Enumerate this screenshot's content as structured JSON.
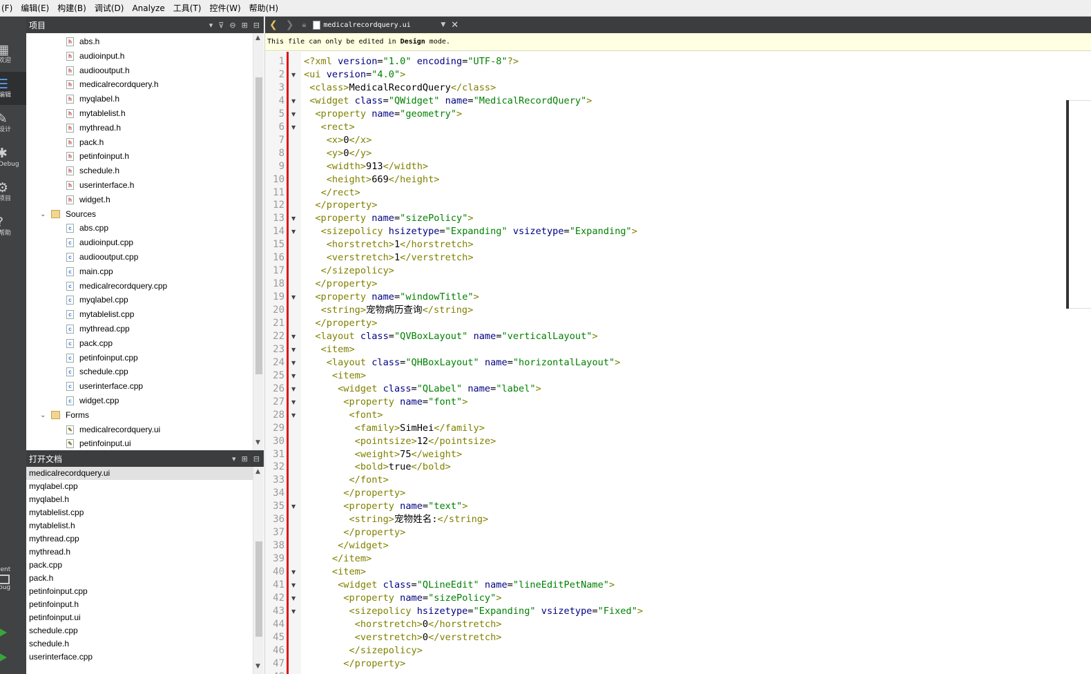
{
  "menu": [
    "(F)",
    "编辑(E)",
    "构建(B)",
    "调试(D)",
    "Analyze",
    "工具(T)",
    "控件(W)",
    "帮助(H)"
  ],
  "modes": [
    {
      "icon": "grid-icon",
      "glyph": "▦",
      "label": "欢迎",
      "active": false
    },
    {
      "icon": "edit-mode-icon",
      "glyph": "☰",
      "label": "编辑",
      "active": true
    },
    {
      "icon": "design-icon",
      "glyph": "✎",
      "label": "设计",
      "active": false
    },
    {
      "icon": "debug-icon",
      "glyph": "✱",
      "label": "Debug",
      "active": false
    },
    {
      "icon": "wrench-icon",
      "glyph": "⚙",
      "label": "项目",
      "active": false
    },
    {
      "icon": "help-icon",
      "glyph": "?",
      "label": "帮助",
      "active": false
    }
  ],
  "kit": {
    "label": "ient",
    "sublabel": "bug"
  },
  "project_panel": {
    "title": "项目"
  },
  "project_tree": [
    {
      "type": "h",
      "label": "abs.h",
      "indent": 2
    },
    {
      "type": "h",
      "label": "audioinput.h",
      "indent": 2
    },
    {
      "type": "h",
      "label": "audiooutput.h",
      "indent": 2
    },
    {
      "type": "h",
      "label": "medicalrecordquery.h",
      "indent": 2
    },
    {
      "type": "h",
      "label": "myqlabel.h",
      "indent": 2
    },
    {
      "type": "h",
      "label": "mytablelist.h",
      "indent": 2
    },
    {
      "type": "h",
      "label": "mythread.h",
      "indent": 2
    },
    {
      "type": "h",
      "label": "pack.h",
      "indent": 2
    },
    {
      "type": "h",
      "label": "petinfoinput.h",
      "indent": 2
    },
    {
      "type": "h",
      "label": "schedule.h",
      "indent": 2
    },
    {
      "type": "h",
      "label": "userinterface.h",
      "indent": 2
    },
    {
      "type": "h",
      "label": "widget.h",
      "indent": 2
    },
    {
      "type": "folder",
      "label": "Sources",
      "indent": 1
    },
    {
      "type": "c",
      "label": "abs.cpp",
      "indent": 2
    },
    {
      "type": "c",
      "label": "audioinput.cpp",
      "indent": 2
    },
    {
      "type": "c",
      "label": "audiooutput.cpp",
      "indent": 2
    },
    {
      "type": "c",
      "label": "main.cpp",
      "indent": 2
    },
    {
      "type": "c",
      "label": "medicalrecordquery.cpp",
      "indent": 2
    },
    {
      "type": "c",
      "label": "myqlabel.cpp",
      "indent": 2
    },
    {
      "type": "c",
      "label": "mytablelist.cpp",
      "indent": 2
    },
    {
      "type": "c",
      "label": "mythread.cpp",
      "indent": 2
    },
    {
      "type": "c",
      "label": "pack.cpp",
      "indent": 2
    },
    {
      "type": "c",
      "label": "petinfoinput.cpp",
      "indent": 2
    },
    {
      "type": "c",
      "label": "schedule.cpp",
      "indent": 2
    },
    {
      "type": "c",
      "label": "userinterface.cpp",
      "indent": 2
    },
    {
      "type": "c",
      "label": "widget.cpp",
      "indent": 2
    },
    {
      "type": "folder",
      "label": "Forms",
      "indent": 1
    },
    {
      "type": "ui",
      "label": "medicalrecordquery.ui",
      "indent": 2
    },
    {
      "type": "ui",
      "label": "petinfoinput.ui",
      "indent": 2
    }
  ],
  "open_docs_panel": {
    "title": "打开文档"
  },
  "open_docs": [
    "medicalrecordquery.ui",
    "myqlabel.cpp",
    "myqlabel.h",
    "mytablelist.cpp",
    "mytablelist.h",
    "mythread.cpp",
    "mythread.h",
    "pack.cpp",
    "pack.h",
    "petinfoinput.cpp",
    "petinfoinput.h",
    "petinfoinput.ui",
    "schedule.cpp",
    "schedule.h",
    "userinterface.cpp"
  ],
  "editor": {
    "filename": "medicalrecordquery.ui",
    "info_prefix": "This file can only be edited in ",
    "info_bold": "Design",
    "info_suffix": " mode.",
    "first_line": 1,
    "lines": [
      "<?xml version=\"1.0\" encoding=\"UTF-8\"?>",
      "<ui version=\"4.0\">",
      " <class>MedicalRecordQuery</class>",
      " <widget class=\"QWidget\" name=\"MedicalRecordQuery\">",
      "  <property name=\"geometry\">",
      "   <rect>",
      "    <x>0</x>",
      "    <y>0</y>",
      "    <width>913</width>",
      "    <height>669</height>",
      "   </rect>",
      "  </property>",
      "  <property name=\"sizePolicy\">",
      "   <sizepolicy hsizetype=\"Expanding\" vsizetype=\"Expanding\">",
      "    <horstretch>1</horstretch>",
      "    <verstretch>1</verstretch>",
      "   </sizepolicy>",
      "  </property>",
      "  <property name=\"windowTitle\">",
      "   <string>宠物病历查询</string>",
      "  </property>",
      "  <layout class=\"QVBoxLayout\" name=\"verticalLayout\">",
      "   <item>",
      "    <layout class=\"QHBoxLayout\" name=\"horizontalLayout\">",
      "     <item>",
      "      <widget class=\"QLabel\" name=\"label\">",
      "       <property name=\"font\">",
      "        <font>",
      "         <family>SimHei</family>",
      "         <pointsize>12</pointsize>",
      "         <weight>75</weight>",
      "         <bold>true</bold>",
      "        </font>",
      "       </property>",
      "       <property name=\"text\">",
      "        <string>宠物姓名:</string>",
      "       </property>",
      "      </widget>",
      "     </item>",
      "     <item>",
      "      <widget class=\"QLineEdit\" name=\"lineEditPetName\">",
      "       <property name=\"sizePolicy\">",
      "        <sizepolicy hsizetype=\"Expanding\" vsizetype=\"Fixed\">",
      "         <horstretch>0</horstretch>",
      "         <verstretch>0</verstretch>",
      "        </sizepolicy>",
      "       </property>"
    ],
    "foldable_lines": [
      2,
      4,
      5,
      6,
      13,
      14,
      19,
      22,
      23,
      24,
      25,
      26,
      27,
      28,
      35,
      40,
      41,
      42,
      43
    ]
  }
}
